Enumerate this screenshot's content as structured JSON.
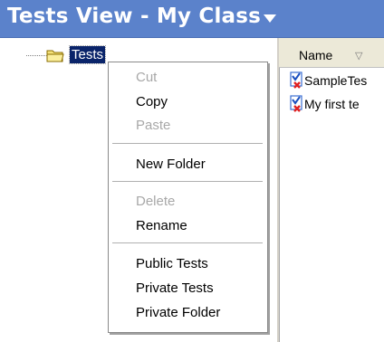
{
  "title": {
    "text": "Tests View - My Class"
  },
  "tree": {
    "root_label": "Tests"
  },
  "list": {
    "column_header": "Name",
    "sort_glyph": "▽",
    "items": [
      {
        "label": "SampleTes"
      },
      {
        "label": "My first te"
      }
    ]
  },
  "context_menu": {
    "cut": "Cut",
    "copy": "Copy",
    "paste": "Paste",
    "new_folder": "New Folder",
    "delete": "Delete",
    "rename": "Rename",
    "public_tests": "Public Tests",
    "private_tests": "Private Tests",
    "private_folder": "Private Folder"
  },
  "colors": {
    "title_bar": "#5b82cb",
    "selection": "#0a246a",
    "disabled_text": "#a8a8a8"
  },
  "icons": [
    "chevron-down-icon",
    "folder-icon",
    "test-document-icon"
  ]
}
